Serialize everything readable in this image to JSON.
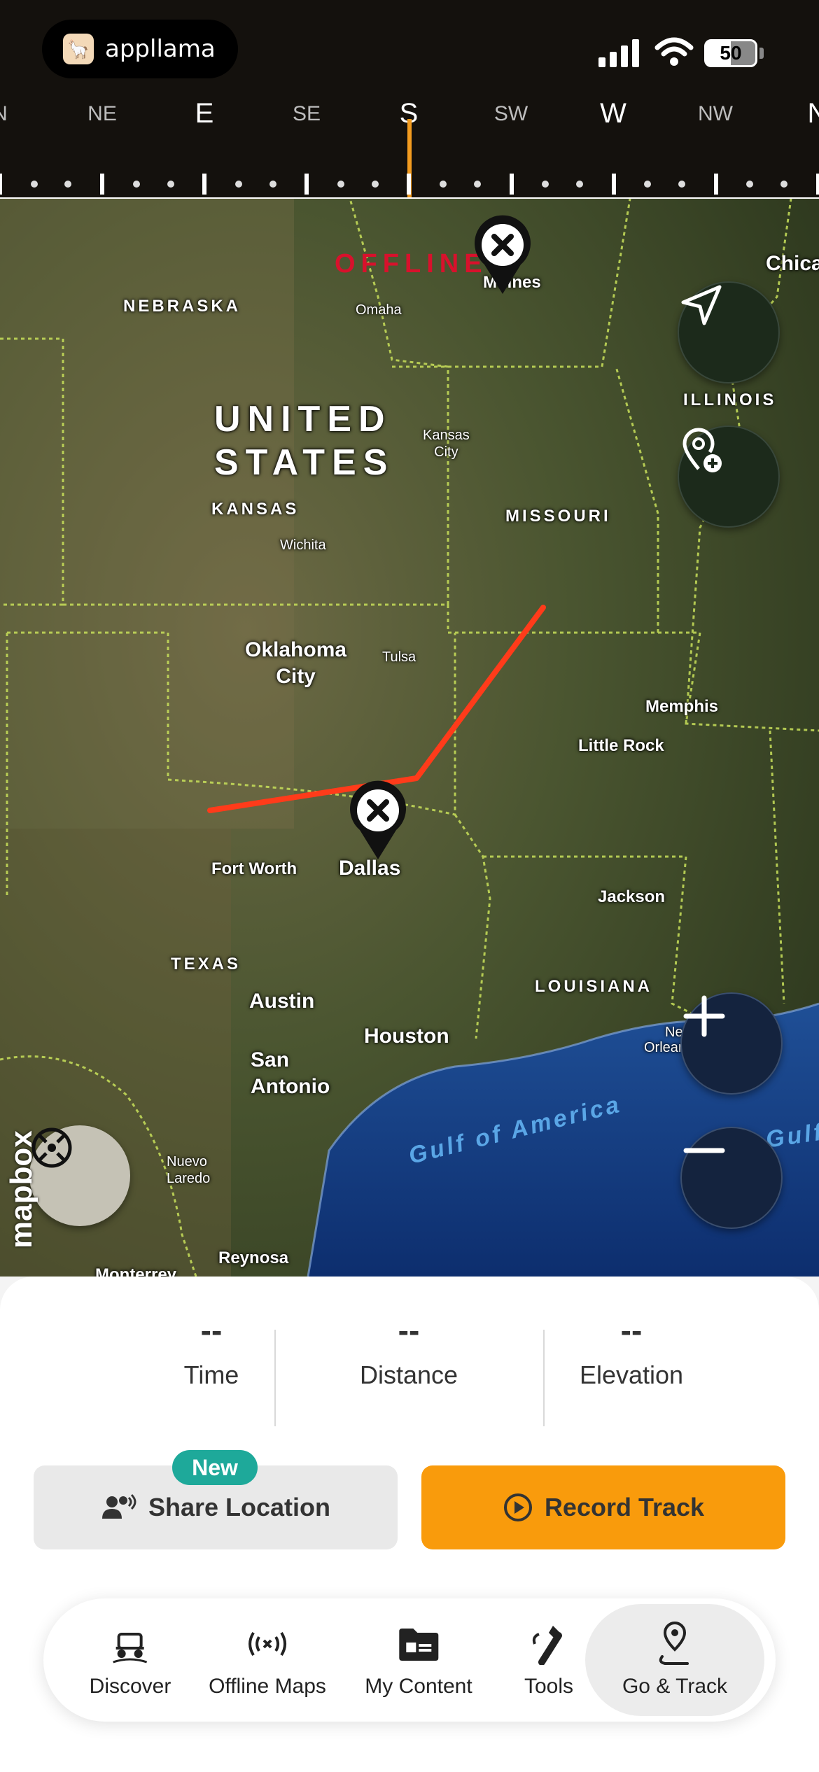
{
  "status_bar": {
    "app_name": "appllama",
    "battery": "50",
    "icons": [
      "cellular-signal-icon",
      "wifi-icon",
      "battery-icon"
    ]
  },
  "compass": {
    "heading": "S",
    "labels": [
      "N",
      "NE",
      "E",
      "SE",
      "S",
      "SW",
      "W",
      "NW",
      "N"
    ],
    "accent": "#f39c1f"
  },
  "map": {
    "offline_label": "OFFLINE",
    "country_line1": "UNITED",
    "country_line2": "STATES",
    "states": {
      "nebraska": "NEBRASKA",
      "kansas": "KANSAS",
      "missouri": "MISSOURI",
      "illinois": "ILLINOIS",
      "texas": "TEXAS",
      "louisiana": "LOUISIANA"
    },
    "cities": {
      "omaha": "Omaha",
      "des_moines": "Moines",
      "kansas_city_1": "Kansas",
      "kansas_city_2": "City",
      "wichita": "Wichita",
      "okc_1": "Oklahoma",
      "okc_2": "City",
      "tulsa": "Tulsa",
      "memphis": "Memphis",
      "little_rock": "Little Rock",
      "fort_worth": "Fort Worth",
      "dallas": "Dallas",
      "jackson": "Jackson",
      "austin": "Austin",
      "houston": "Houston",
      "san_antonio_1": "San",
      "san_antonio_2": "Antonio",
      "new_orleans_1": "New",
      "new_orleans_2": "Orleans",
      "nuevo_laredo_1": "Nuevo",
      "nuevo_laredo_2": "Laredo",
      "reynosa": "Reynosa",
      "monterrey": "Monterrey",
      "chicago": "Chica"
    },
    "water": {
      "gulf": "Gulf of America",
      "gulf_edge": "Gulf"
    },
    "attribution": "mapbox",
    "route_color": "#ff3b1a"
  },
  "stats": {
    "time_value": "--",
    "time_label": "Time",
    "distance_value": "--",
    "distance_label": "Distance",
    "elevation_value": "--",
    "elevation_label": "Elevation"
  },
  "actions": {
    "share_label": "Share Location",
    "new_badge": "New",
    "record_label": "Record Track",
    "record_color": "#f99b0c"
  },
  "tabbar": {
    "items": [
      {
        "label": "Discover",
        "icon": "offroad-vehicle-icon"
      },
      {
        "label": "Offline Maps",
        "icon": "offline-signal-icon"
      },
      {
        "label": "My Content",
        "icon": "folder-icon"
      },
      {
        "label": "Tools",
        "icon": "tools-icon"
      },
      {
        "label": "Go & Track",
        "icon": "route-pin-icon",
        "active": true
      }
    ]
  }
}
